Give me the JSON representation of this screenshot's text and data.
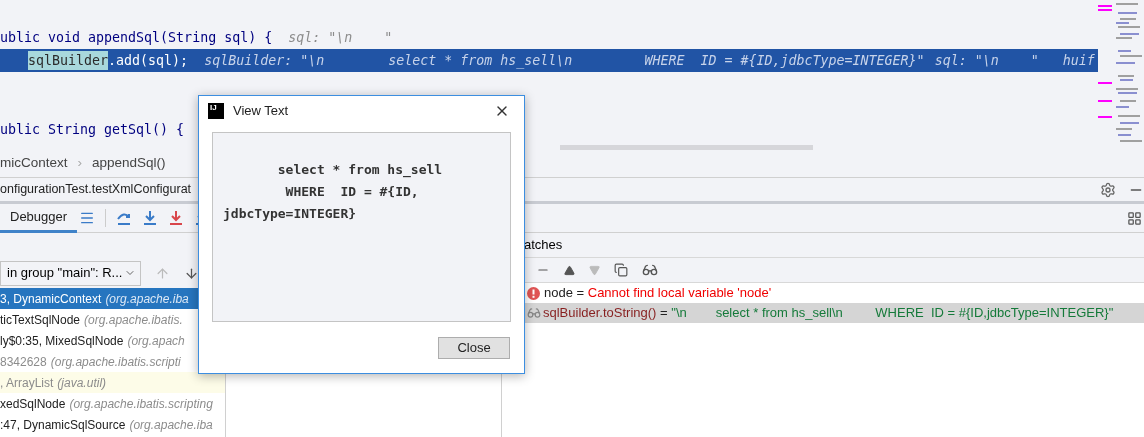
{
  "editor": {
    "lines": [
      {
        "kind": "code",
        "text": "ublic void appendSql(String sql) {",
        "hint": "sql: \"\\n    \""
      },
      {
        "kind": "current",
        "highlight": "sqlBuilder",
        "text": ".add(sql);",
        "hint": "sqlBuilder: \"\\n        select * from hs_sell\\n         WHERE  ID = #{ID,jdbcType=INTEGER}\"",
        "hint_2": "sql: \"\\n    \"   huif"
      },
      {
        "kind": "blank"
      },
      {
        "kind": "blank"
      },
      {
        "kind": "code",
        "text": "ublic String getSql() {"
      }
    ]
  },
  "breadcrumbs": [
    "micContext",
    "appendSql()"
  ],
  "breadcrumb_separator": "›",
  "session_tab": "onfigurationTest.testXmlConfigurat",
  "debugger_tab": {
    "label": "Debugger",
    "selected": true
  },
  "thread_selector": "in group \"main\": R...",
  "frames": [
    {
      "name": "3, DynamicContext",
      "package": "(org.apache.iba",
      "selected": true,
      "dimmed": false,
      "highlighted": false
    },
    {
      "name": "ticTextSqlNode",
      "package": "(org.apache.ibatis.",
      "selected": false,
      "dimmed": false,
      "highlighted": false
    },
    {
      "name": "ly$0:35, MixedSqlNode",
      "package": "(org.apach",
      "selected": false,
      "dimmed": false,
      "highlighted": false
    },
    {
      "name": "8342628",
      "package": "(org.apache.ibatis.scripti",
      "selected": false,
      "dimmed": true,
      "highlighted": false
    },
    {
      "name": ", ArrayList",
      "package": "(java.util)",
      "selected": false,
      "dimmed": true,
      "highlighted": true
    },
    {
      "name": "xedSqlNode",
      "package": "(org.apache.ibatis.scripting",
      "selected": false,
      "dimmed": false,
      "highlighted": false
    },
    {
      "name": ":47, DynamicSqlSource",
      "package": "(org.apache.iba",
      "selected": false,
      "dimmed": false,
      "highlighted": false
    }
  ],
  "watches": {
    "title": "atches",
    "items": [
      {
        "kind": "error",
        "name": "node",
        "operator": " = ",
        "value": "Cannot find local variable 'node'",
        "selected": false
      },
      {
        "kind": "watch",
        "name": "sqlBuilder.toString()",
        "operator": " = ",
        "value": "\"\\n        select * from hs_sell\\n         WHERE  ID = #{ID,jdbcType=INTEGER}\"",
        "selected": true
      }
    ]
  },
  "dialog": {
    "logo": "IJ",
    "title": "View Text",
    "lines": [
      "       select * from hs_sell",
      "        WHERE  ID = #{ID,",
      "jdbcType=INTEGER}"
    ],
    "button": "Close"
  }
}
